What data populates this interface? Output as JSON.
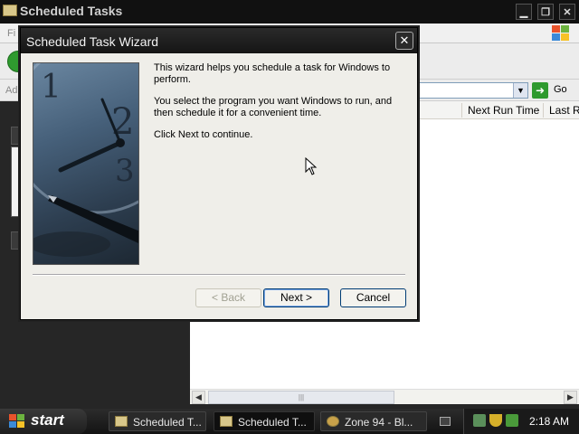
{
  "explorer": {
    "title": "Scheduled Tasks",
    "menu_hint": "Fi",
    "address_label": "Add",
    "go_label": "Go",
    "columns": [
      "Next Run Time",
      "Last Ru"
    ]
  },
  "wizard": {
    "title": "Scheduled Task Wizard",
    "close_glyph": "✕",
    "paragraphs": [
      "This wizard helps you schedule a task for Windows to perform.",
      "You select the program you want Windows to run, and then schedule it for a convenient time.",
      "Click Next to continue."
    ],
    "buttons": {
      "back": "< Back",
      "next": "Next >",
      "cancel": "Cancel"
    }
  },
  "taskbar": {
    "start_label": "start",
    "tasks": [
      "Scheduled T...",
      "Scheduled T...",
      "Zone 94 - Bl..."
    ],
    "clock": "2:18 AM"
  },
  "colors": {
    "titlebar": "#111111",
    "accent_green": "#2f9a2f",
    "dialog_bg": "#efeee9"
  }
}
